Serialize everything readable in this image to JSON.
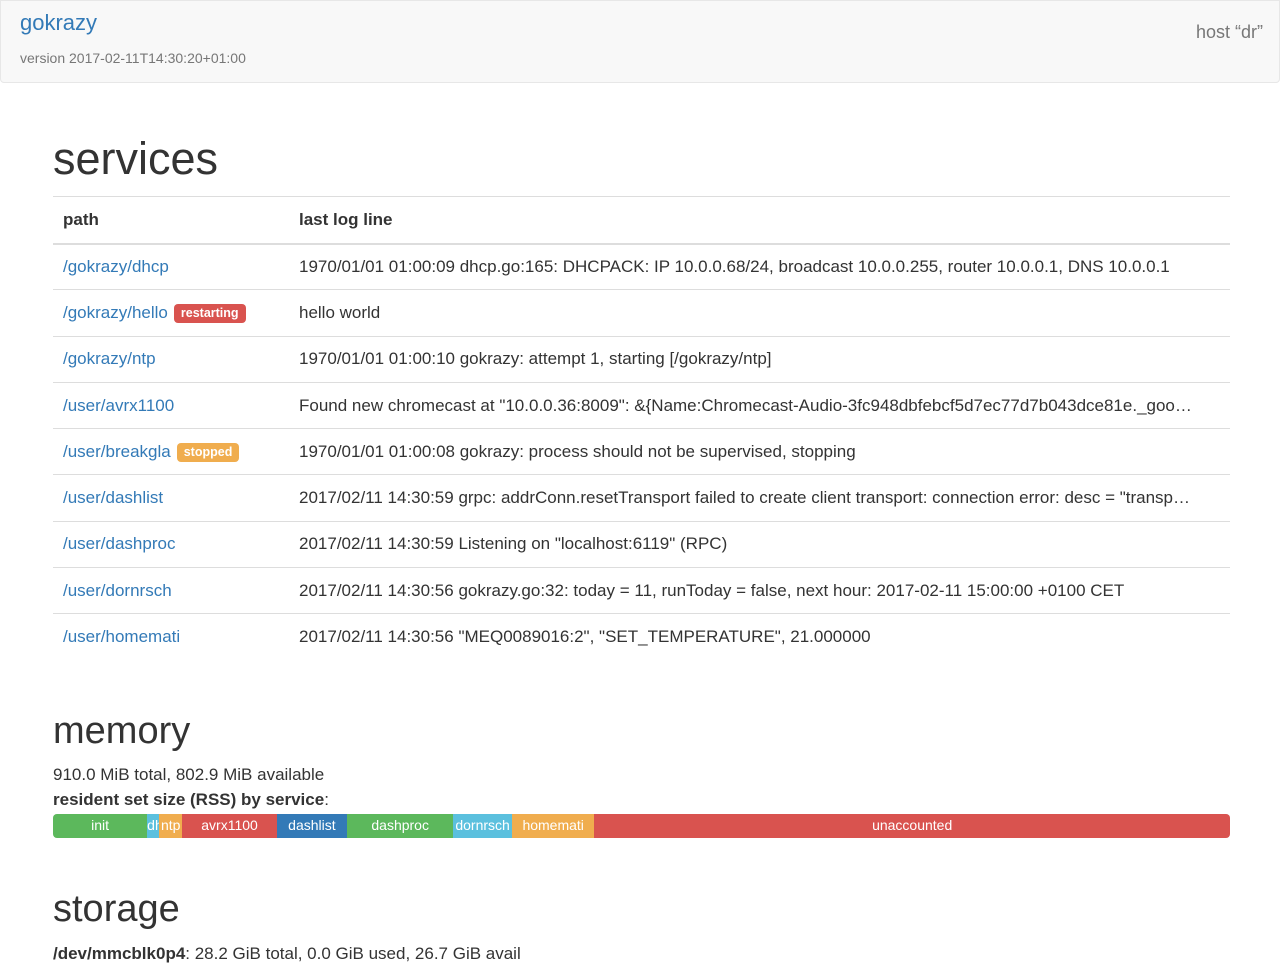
{
  "navbar": {
    "brand": "gokrazy",
    "version": "version 2017-02-11T14:30:20+01:00",
    "host": "host “dr”"
  },
  "services": {
    "heading": "services",
    "columns": [
      "path",
      "last log line"
    ],
    "rows": [
      {
        "path": "/gokrazy/dhcp",
        "badge": "",
        "log": "1970/01/01 01:00:09 dhcp.go:165: DHCPACK: IP 10.0.0.68/24, broadcast 10.0.0.255, router 10.0.0.1, DNS 10.0.0.1"
      },
      {
        "path": "/gokrazy/hello",
        "badge": "restarting",
        "log": "hello world"
      },
      {
        "path": "/gokrazy/ntp",
        "badge": "",
        "log": "1970/01/01 01:00:10 gokrazy: attempt 1, starting [/gokrazy/ntp]"
      },
      {
        "path": "/user/avrx1100",
        "badge": "",
        "log": "Found new chromecast at \"10.0.0.36:8009\": &{Name:Chromecast-Audio-3fc948dbfebcf5d7ec77d7b043dce81e._goo…"
      },
      {
        "path": "/user/breakgla",
        "badge": "stopped",
        "log": "1970/01/01 01:00:08 gokrazy: process should not be supervised, stopping"
      },
      {
        "path": "/user/dashlist",
        "badge": "",
        "log": "2017/02/11 14:30:59 grpc: addrConn.resetTransport failed to create client transport: connection error: desc = \"transp…"
      },
      {
        "path": "/user/dashproc",
        "badge": "",
        "log": "2017/02/11 14:30:59 Listening on \"localhost:6119\" (RPC)"
      },
      {
        "path": "/user/dornrsch",
        "badge": "",
        "log": "2017/02/11 14:30:56 gokrazy.go:32: today = 11, runToday = false, next hour: 2017-02-11 15:00:00 +0100 CET"
      },
      {
        "path": "/user/homemati",
        "badge": "",
        "log": "2017/02/11 14:30:56 \"MEQ0089016:2\", \"SET_TEMPERATURE\", 21.000000"
      }
    ],
    "badge_colors": {
      "restarting": "#d9534f",
      "stopped": "#f0ad4e"
    }
  },
  "memory": {
    "heading": "memory",
    "total_line": "910.0 MiB total, 802.9 MiB available",
    "rss_label": "resident set size (RSS) by service",
    "rss_suffix": ":",
    "segments": [
      {
        "label": "init",
        "percent": 8.0,
        "color": "#5cb85c"
      },
      {
        "label": "dhcp",
        "percent": 1.0,
        "color": "#5bc0de"
      },
      {
        "label": "ntp",
        "percent": 2.0,
        "color": "#f0ad4e"
      },
      {
        "label": "avrx1100",
        "percent": 8.0,
        "color": "#d9534f"
      },
      {
        "label": "dashlist",
        "percent": 6.0,
        "color": "#337ab7"
      },
      {
        "label": "dashproc",
        "percent": 9.0,
        "color": "#5cb85c"
      },
      {
        "label": "dornrsch",
        "percent": 5.0,
        "color": "#5bc0de"
      },
      {
        "label": "homemati",
        "percent": 7.0,
        "color": "#f0ad4e"
      },
      {
        "label": "unaccounted",
        "percent": 54.0,
        "color": "#d9534f"
      }
    ]
  },
  "storage": {
    "heading": "storage",
    "device": "/dev/mmcblk0p4",
    "details": ": 28.2 GiB total, 0.0 GiB used, 26.7 GiB avail"
  }
}
